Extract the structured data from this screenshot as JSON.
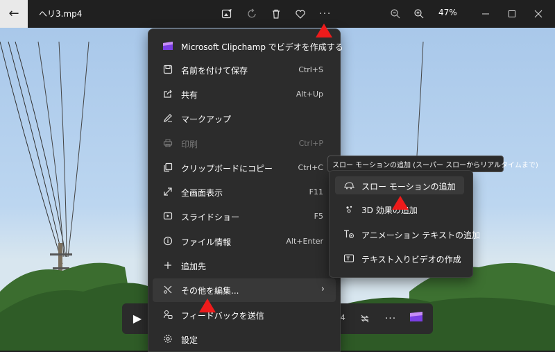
{
  "titlebar": {
    "file_name": "ヘリ3.mp4",
    "zoom_level": "47%"
  },
  "menu": {
    "items": [
      {
        "label": "Microsoft Clipchamp でビデオを作成する",
        "shortcut": "",
        "icon": "clipchamp-icon"
      },
      {
        "label": "名前を付けて保存",
        "shortcut": "Ctrl+S",
        "icon": "save-icon"
      },
      {
        "label": "共有",
        "shortcut": "Alt+Up",
        "icon": "share-icon"
      },
      {
        "label": "マークアップ",
        "shortcut": "",
        "icon": "pen-icon"
      },
      {
        "label": "印刷",
        "shortcut": "Ctrl+P",
        "icon": "printer-icon",
        "disabled": true
      },
      {
        "label": "クリップボードにコピー",
        "shortcut": "Ctrl+C",
        "icon": "copy-icon"
      },
      {
        "label": "全画面表示",
        "shortcut": "F11",
        "icon": "fullscreen-icon"
      },
      {
        "label": "スライドショー",
        "shortcut": "F5",
        "icon": "slideshow-icon"
      },
      {
        "label": "ファイル情報",
        "shortcut": "Alt+Enter",
        "icon": "info-icon"
      },
      {
        "label": "追加先",
        "shortcut": "",
        "icon": "plus-icon"
      },
      {
        "label": "その他を編集...",
        "shortcut": "",
        "icon": "edit-more-icon",
        "has_submenu": true
      },
      {
        "label": "フィードバックを送信",
        "shortcut": "",
        "icon": "feedback-icon"
      },
      {
        "label": "設定",
        "shortcut": "",
        "icon": "settings-icon"
      }
    ]
  },
  "submenu": {
    "tooltip": "スロー モーションの追加 (スーパー スローからリアルタイムまで)",
    "items": [
      {
        "label": "スロー モーションの追加",
        "icon": "slow-motion-icon"
      },
      {
        "label": "3D 効果の追加",
        "icon": "3d-effect-icon"
      },
      {
        "label": "アニメーション テキストの追加",
        "icon": "animated-text-icon"
      },
      {
        "label": "テキスト入りビデオの作成",
        "icon": "video-text-icon"
      }
    ]
  },
  "controls": {
    "time_fragment": ":4"
  },
  "colors": {
    "marker": "#ee1b1b",
    "menu_bg": "#2c2c2c",
    "sky": "#bcd6f0"
  }
}
